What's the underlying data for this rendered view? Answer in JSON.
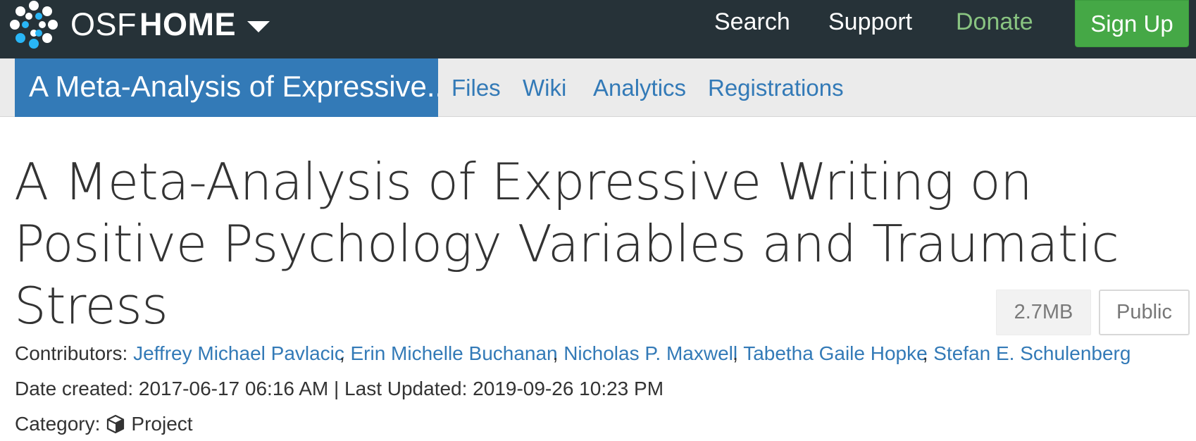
{
  "topnav": {
    "brand_osf": "OSF",
    "brand_home": "HOME",
    "links": {
      "search": "Search",
      "support": "Support",
      "donate": "Donate"
    },
    "signup_label": "Sign Up",
    "colors": {
      "background": "#263238",
      "donate": "#89c481",
      "signup": "#45a846"
    },
    "icons": {
      "logo": "osf-logo-icon",
      "caret": "caret-down-icon"
    }
  },
  "subnav": {
    "project_title": "A Meta-Analysis of Expressive...",
    "tabs": {
      "files": "Files",
      "wiki": "Wiki",
      "analytics": "Analytics",
      "registrations": "Registrations"
    },
    "colors": {
      "active": "#337ab7",
      "background": "#ebebeb"
    }
  },
  "project": {
    "title": "A Meta-Analysis of Expressive Writing on Positive Psychology Variables and Traumatic Stress",
    "size_badge": "2.7MB",
    "visibility_badge": "Public",
    "contributors_label": "Contributors:",
    "contributors": [
      "Jeffrey Michael Pavlacic",
      "Erin Michelle Buchanan",
      "Nicholas P. Maxwell",
      "Tabetha Gaile Hopke",
      "Stefan E. Schulenberg"
    ],
    "separator": ", ",
    "date_created_label": "Date created:",
    "date_created": "2017-06-17 06:16 AM",
    "pipe": "|",
    "last_updated_label": "Last Updated:",
    "last_updated": "2019-09-26 10:23 PM",
    "category_label": "Category:",
    "category": "Project",
    "category_icon": "cube-icon"
  }
}
